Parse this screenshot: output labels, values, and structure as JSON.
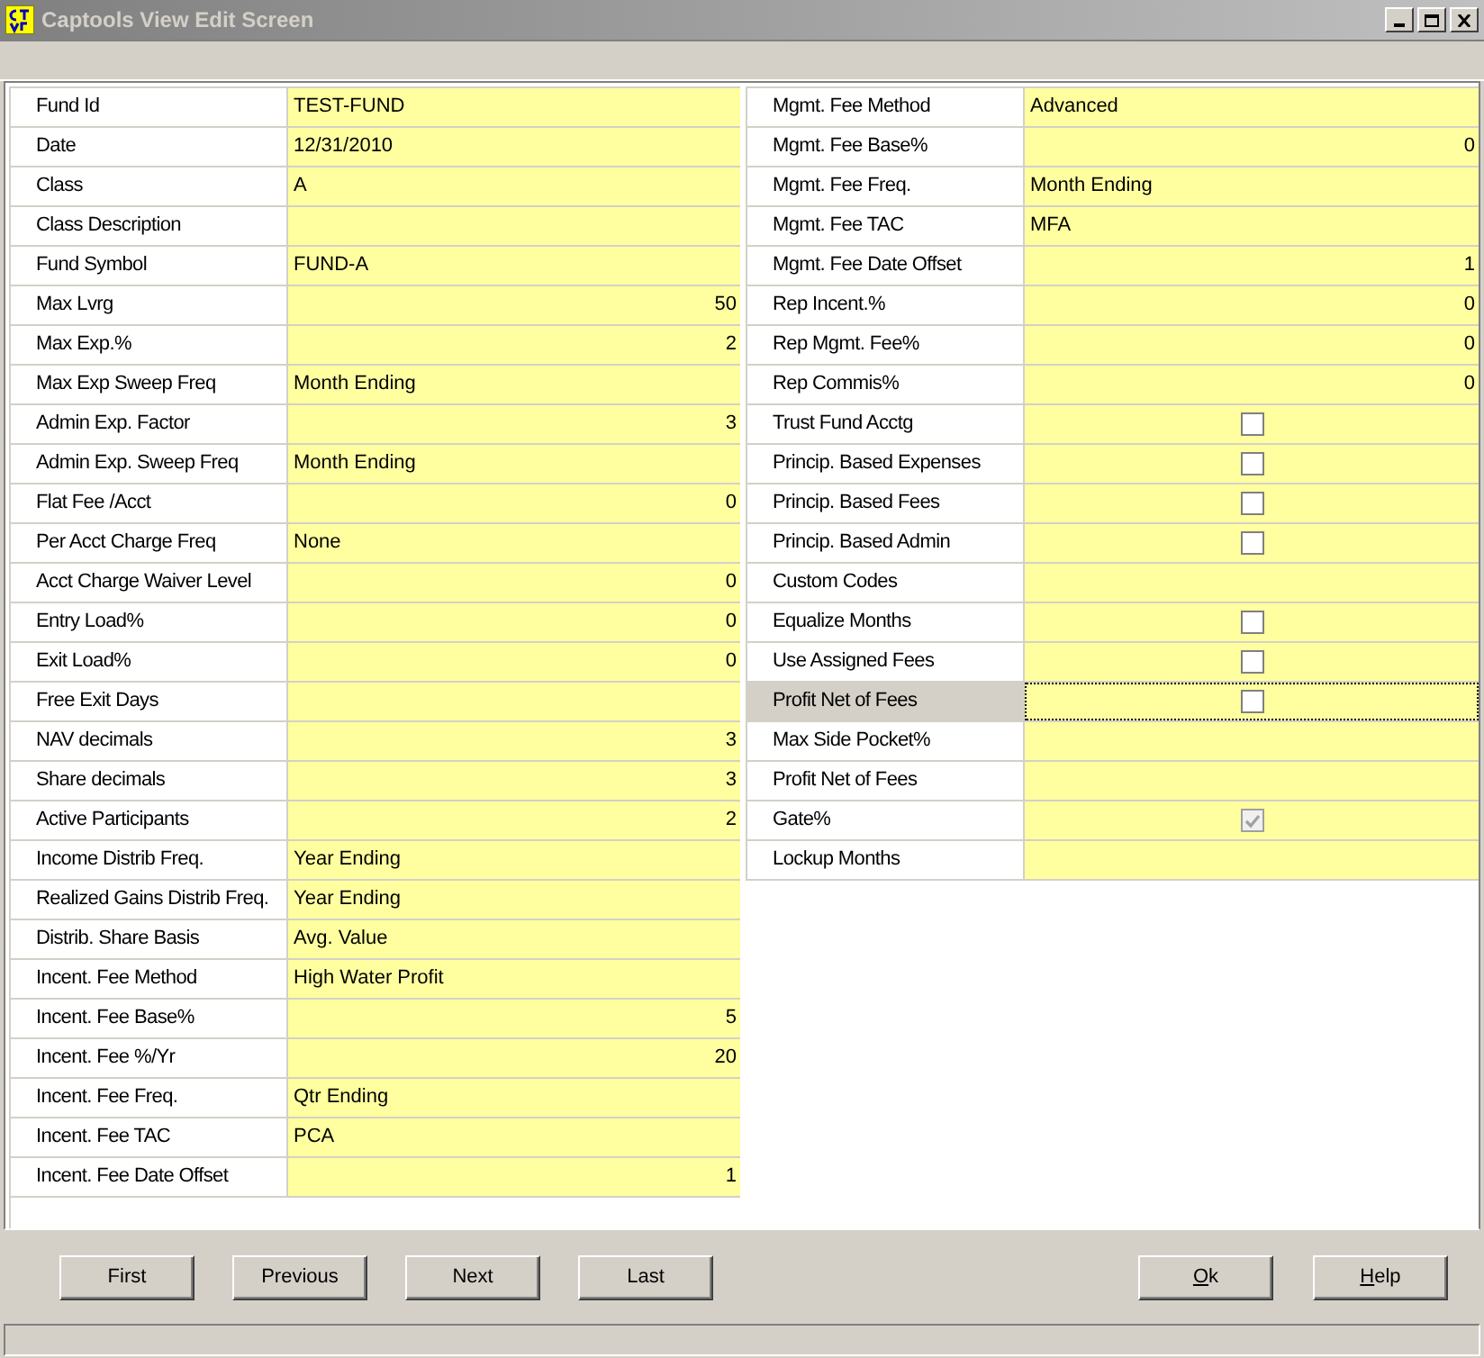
{
  "window": {
    "title": "Captools View Edit Screen"
  },
  "left_fields": [
    {
      "label": "Fund Id",
      "kind": "text",
      "value": "TEST-FUND",
      "selected": false
    },
    {
      "label": "Date",
      "kind": "text",
      "value": "12/31/2010",
      "selected": false
    },
    {
      "label": "Class",
      "kind": "text",
      "value": "A",
      "selected": false
    },
    {
      "label": "Class Description",
      "kind": "empty",
      "selected": false
    },
    {
      "label": "Fund Symbol",
      "kind": "text",
      "value": "FUND-A",
      "selected": false
    },
    {
      "label": "Max Lvrg",
      "kind": "number",
      "value": "50",
      "selected": false
    },
    {
      "label": "Max Exp.%",
      "kind": "number",
      "value": "2",
      "selected": false
    },
    {
      "label": "Max Exp Sweep Freq",
      "kind": "text",
      "value": "Month Ending",
      "selected": false
    },
    {
      "label": "Admin Exp. Factor",
      "kind": "number",
      "value": "3",
      "selected": false
    },
    {
      "label": "Admin Exp. Sweep Freq",
      "kind": "text",
      "value": "Month Ending",
      "selected": false
    },
    {
      "label": "Flat Fee /Acct",
      "kind": "number",
      "value": "0",
      "selected": false
    },
    {
      "label": "Per Acct Charge Freq",
      "kind": "text",
      "value": "None",
      "selected": false
    },
    {
      "label": "Acct Charge Waiver Level",
      "kind": "number",
      "value": "0",
      "selected": false
    },
    {
      "label": "Entry Load%",
      "kind": "number",
      "value": "0",
      "selected": false
    },
    {
      "label": "Exit Load%",
      "kind": "number",
      "value": "0",
      "selected": false
    },
    {
      "label": "Free Exit Days",
      "kind": "empty",
      "selected": false
    },
    {
      "label": "NAV decimals",
      "kind": "number",
      "value": "3",
      "selected": false
    },
    {
      "label": "Share decimals",
      "kind": "number",
      "value": "3",
      "selected": false
    },
    {
      "label": "Active Participants",
      "kind": "number",
      "value": "2",
      "selected": false
    },
    {
      "label": "Income Distrib Freq.",
      "kind": "text",
      "value": "Year Ending",
      "selected": false
    },
    {
      "label": "Realized Gains Distrib Freq.",
      "kind": "text",
      "value": "Year Ending",
      "selected": false
    },
    {
      "label": "Distrib. Share Basis",
      "kind": "text",
      "value": "Avg. Value",
      "selected": false
    },
    {
      "label": "Incent. Fee Method",
      "kind": "text",
      "value": "High Water Profit",
      "selected": false
    },
    {
      "label": "Incent. Fee Base%",
      "kind": "number",
      "value": "5",
      "selected": false
    },
    {
      "label": "Incent. Fee %/Yr",
      "kind": "number",
      "value": "20",
      "selected": false
    },
    {
      "label": "Incent. Fee Freq.",
      "kind": "text",
      "value": "Qtr Ending",
      "selected": false
    },
    {
      "label": "Incent. Fee TAC",
      "kind": "text",
      "value": "PCA",
      "selected": false
    },
    {
      "label": "Incent. Fee Date Offset",
      "kind": "number",
      "value": "1",
      "selected": false
    }
  ],
  "right_fields": [
    {
      "label": "Mgmt. Fee Method",
      "kind": "text",
      "value": "Advanced",
      "selected": false
    },
    {
      "label": "Mgmt. Fee Base%",
      "kind": "number",
      "value": "0",
      "selected": false
    },
    {
      "label": "Mgmt. Fee Freq.",
      "kind": "text",
      "value": "Month Ending",
      "selected": false
    },
    {
      "label": "Mgmt. Fee TAC",
      "kind": "text",
      "value": "MFA",
      "selected": false
    },
    {
      "label": "Mgmt. Fee Date Offset",
      "kind": "number",
      "value": "1",
      "selected": false
    },
    {
      "label": "Rep Incent.%",
      "kind": "number",
      "value": "0",
      "selected": false
    },
    {
      "label": "Rep Mgmt. Fee%",
      "kind": "number",
      "value": "0",
      "selected": false
    },
    {
      "label": "Rep Commis%",
      "kind": "number",
      "value": "0",
      "selected": false
    },
    {
      "label": "Trust Fund Acctg",
      "kind": "checkbox",
      "checked": false,
      "disabled": false,
      "selected": false
    },
    {
      "label": "Princip. Based Expenses",
      "kind": "checkbox",
      "checked": false,
      "disabled": false,
      "selected": false
    },
    {
      "label": "Princip. Based Fees",
      "kind": "checkbox",
      "checked": false,
      "disabled": false,
      "selected": false
    },
    {
      "label": "Princip. Based Admin",
      "kind": "checkbox",
      "checked": false,
      "disabled": false,
      "selected": false
    },
    {
      "label": "Custom Codes",
      "kind": "empty",
      "selected": false
    },
    {
      "label": "Equalize Months",
      "kind": "checkbox",
      "checked": false,
      "disabled": false,
      "selected": false
    },
    {
      "label": "Use Assigned Fees",
      "kind": "checkbox",
      "checked": false,
      "disabled": false,
      "selected": false
    },
    {
      "label": "Profit Net of Fees",
      "kind": "checkbox",
      "checked": false,
      "disabled": false,
      "selected": true
    },
    {
      "label": "Max Side Pocket%",
      "kind": "empty",
      "selected": false
    },
    {
      "label": "Profit Net of Fees",
      "kind": "empty",
      "selected": false
    },
    {
      "label": "Gate%",
      "kind": "checkbox",
      "checked": true,
      "disabled": true,
      "selected": false
    },
    {
      "label": "Lockup Months",
      "kind": "empty",
      "selected": false
    }
  ],
  "nav_buttons": [
    {
      "label": "First",
      "mnemonic": false
    },
    {
      "label": "Previous",
      "mnemonic": false
    },
    {
      "label": "Next",
      "mnemonic": false
    },
    {
      "label": "Last",
      "mnemonic": false
    }
  ],
  "dialog_buttons": [
    {
      "label": "Ok",
      "mnemonic": true
    },
    {
      "label": "Help",
      "mnemonic": true
    }
  ]
}
